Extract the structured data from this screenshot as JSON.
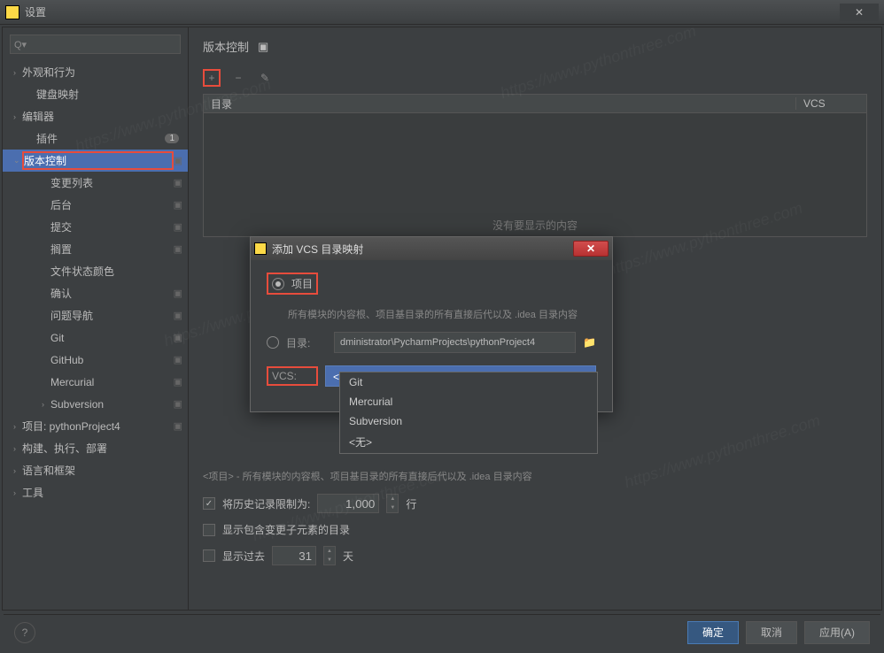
{
  "window": {
    "title": "设置",
    "close": "✕"
  },
  "search": {
    "placeholder": ""
  },
  "sidebar": {
    "items": [
      {
        "label": "外观和行为",
        "arrow": "›",
        "indent": 0
      },
      {
        "label": "键盘映射",
        "arrow": "",
        "indent": 1
      },
      {
        "label": "编辑器",
        "arrow": "›",
        "indent": 0
      },
      {
        "label": "插件",
        "arrow": "",
        "indent": 1,
        "badge": "1"
      },
      {
        "label": "版本控制",
        "arrow": "⌄",
        "indent": 0,
        "selected": true,
        "cfg": true,
        "red": true
      },
      {
        "label": "变更列表",
        "arrow": "",
        "indent": 2,
        "cfg": true
      },
      {
        "label": "后台",
        "arrow": "",
        "indent": 2,
        "cfg": true
      },
      {
        "label": "提交",
        "arrow": "",
        "indent": 2,
        "cfg": true
      },
      {
        "label": "搁置",
        "arrow": "",
        "indent": 2,
        "cfg": true
      },
      {
        "label": "文件状态颜色",
        "arrow": "",
        "indent": 2
      },
      {
        "label": "确认",
        "arrow": "",
        "indent": 2,
        "cfg": true
      },
      {
        "label": "问题导航",
        "arrow": "",
        "indent": 2,
        "cfg": true
      },
      {
        "label": "Git",
        "arrow": "",
        "indent": 2,
        "cfg": true
      },
      {
        "label": "GitHub",
        "arrow": "",
        "indent": 2,
        "cfg": true
      },
      {
        "label": "Mercurial",
        "arrow": "",
        "indent": 2,
        "cfg": true
      },
      {
        "label": "Subversion",
        "arrow": "›",
        "indent": 2,
        "cfg": true
      },
      {
        "label": "项目: pythonProject4",
        "arrow": "›",
        "indent": 0,
        "cfg": true
      },
      {
        "label": "构建、执行、部署",
        "arrow": "›",
        "indent": 0
      },
      {
        "label": "语言和框架",
        "arrow": "›",
        "indent": 0
      },
      {
        "label": "工具",
        "arrow": "›",
        "indent": 0
      }
    ]
  },
  "breadcrumb": {
    "title": "版本控制"
  },
  "toolbar": {
    "add": "+",
    "remove": "−",
    "edit": "✎"
  },
  "table": {
    "col_directory": "目录",
    "col_vcs": "VCS",
    "empty": "没有要显示的内容"
  },
  "hint": "<项目> - 所有模块的内容根、项目基目录的所有直接后代以及 .idea 目录内容",
  "history": {
    "checkbox_label": "将历史记录限制为:",
    "value": "1,000",
    "unit": "行"
  },
  "show_sub": {
    "label": "显示包含变更子元素的目录"
  },
  "show_past": {
    "label": "显示过去",
    "value": "31",
    "unit": "天"
  },
  "footer": {
    "ok": "确定",
    "cancel": "取消",
    "apply": "应用(A)",
    "help": "?"
  },
  "dialog": {
    "title": "添加 VCS 目录映射",
    "close": "✕",
    "radio_project": "项目",
    "hint": "所有模块的内容根、项目基目录的所有直接后代以及 .idea 目录内容",
    "radio_directory": "目录:",
    "path": "dministrator\\PycharmProjects\\pythonProject4",
    "vcs_label": "VCS:",
    "vcs_value": "<无>",
    "options": [
      "Git",
      "Mercurial",
      "Subversion",
      "<无>"
    ]
  },
  "watermark": "https://www.pythonthree.com"
}
